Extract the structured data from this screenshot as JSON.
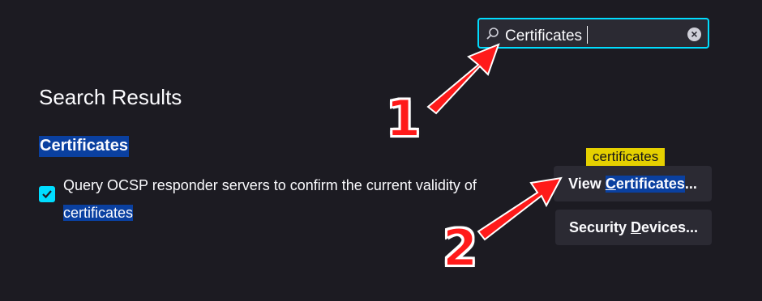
{
  "search": {
    "value": "Certificates"
  },
  "heading": "Search Results",
  "section": {
    "title": "Certificates"
  },
  "preference": {
    "text_before": "Query OCSP responder servers to confirm the current validity of",
    "text_highlight": "certificates",
    "checked": true
  },
  "tooltip": {
    "text": "certificates"
  },
  "buttons": {
    "view_prefix": "View ",
    "view_highlight": "Certificates",
    "view_suffix": "...",
    "security_label": "Security Devices..."
  },
  "annotations": {
    "step1": "1",
    "step2": "2"
  },
  "colors": {
    "accent": "#00ddff",
    "highlight": "#0a40a0",
    "tooltip": "#e5d000",
    "arrow": "#ff1a1a"
  }
}
